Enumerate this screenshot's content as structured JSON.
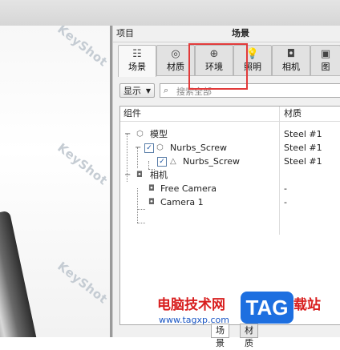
{
  "viewport": {
    "watermark": "KeyShot"
  },
  "panel": {
    "project_label": "项目",
    "title": "场景",
    "tabs": [
      {
        "label": "场景",
        "icon": "scene-icon"
      },
      {
        "label": "材质",
        "icon": "material-icon"
      },
      {
        "label": "环境",
        "icon": "globe-icon"
      },
      {
        "label": "照明",
        "icon": "lightbulb-icon"
      },
      {
        "label": "相机",
        "icon": "camera-icon"
      },
      {
        "label": "图",
        "icon": "image-icon"
      }
    ],
    "highlight_color": "#e23a3a",
    "display_button": "显示",
    "search_placeholder": "搜索全部",
    "tree": {
      "col_component": "组件",
      "col_material": "材质",
      "rows": [
        {
          "label": "模型",
          "material": "Steel #1"
        },
        {
          "label": "Nurbs_Screw",
          "material": "Steel #1"
        },
        {
          "label": "Nurbs_Screw",
          "material": "Steel #1"
        },
        {
          "label": "相机",
          "material": ""
        },
        {
          "label": "Free Camera",
          "material": "-"
        },
        {
          "label": "Camera 1",
          "material": "-"
        }
      ]
    },
    "bottom_tabs": [
      "场景",
      "材质"
    ]
  },
  "site_watermark": {
    "text_left": "电脑技术网",
    "logo": "TAG",
    "text_right": "载站",
    "url": "www.tagxp.com"
  }
}
